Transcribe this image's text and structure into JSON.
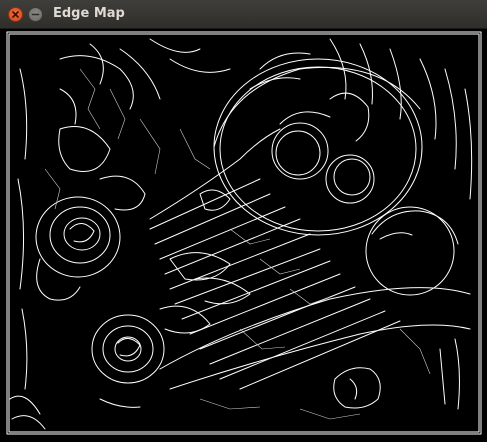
{
  "window": {
    "title": "Edge Map"
  },
  "titlebar_buttons": [
    {
      "name": "close",
      "icon": "close-icon"
    },
    {
      "name": "minimize",
      "icon": "minimize-icon"
    }
  ],
  "image": {
    "description_icon": "edge-map-image",
    "stroke_color": "#ffffff",
    "background_color": "#000000"
  }
}
